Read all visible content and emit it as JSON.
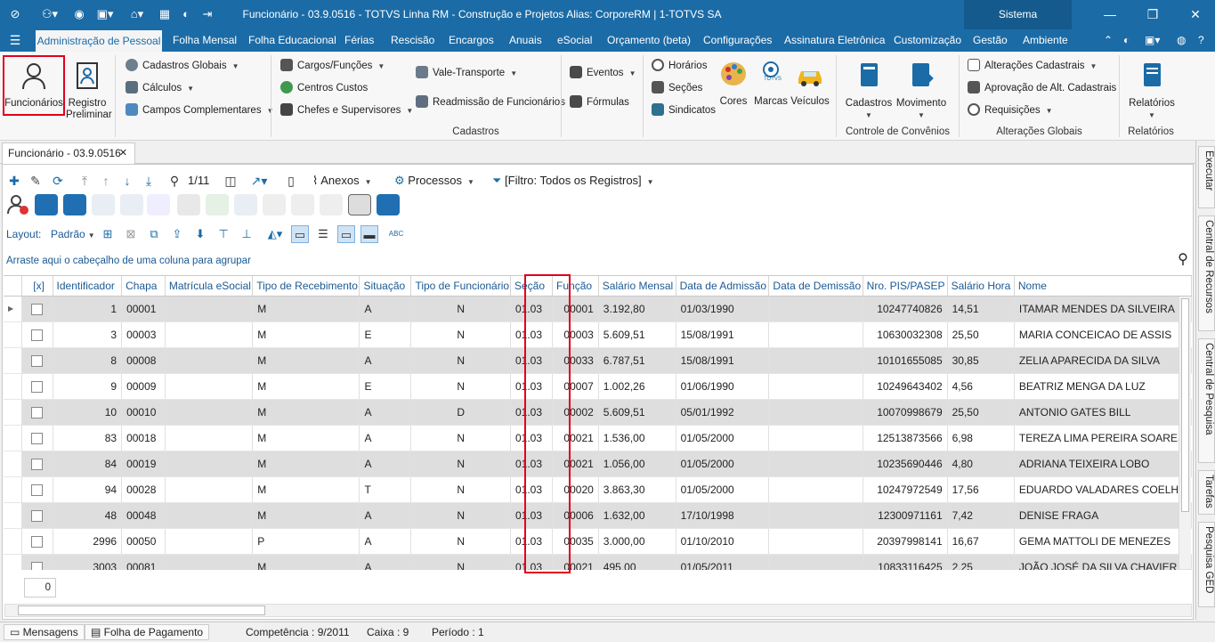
{
  "window": {
    "title": "Funcionário - 03.9.0516 - TOTVS Linha RM - Construção e Projetos  Alias: CorporeRM | 1-TOTVS SA",
    "system_label": "Sistema"
  },
  "ribbon_tabs": [
    "Administração de Pessoal",
    "Folha Mensal",
    "Folha Educacional",
    "Férias",
    "Rescisão",
    "Encargos",
    "Anuais",
    "eSocial",
    "Orçamento (beta)",
    "Configurações",
    "Assinatura Eletrônica",
    "Customização",
    "Gestão",
    "Ambiente"
  ],
  "ribbon": {
    "funcionarios": "Funcionários",
    "registro_preliminar_1": "Registro",
    "registro_preliminar_2": "Preliminar",
    "cadastros_globais": "Cadastros Globais",
    "calculos": "Cálculos",
    "campos_complementares": "Campos Complementares",
    "cargos_funcoes": "Cargos/Funções",
    "centros_custos": "Centros Custos",
    "chefes_supervisores": "Chefes e Supervisores",
    "vale_transporte": "Vale-Transporte",
    "readmissao": "Readmissão de Funcionários",
    "eventos": "Eventos",
    "formulas": "Fórmulas",
    "horarios": "Horários",
    "secoes": "Seções",
    "sindicatos": "Sindicatos",
    "cores": "Cores",
    "marcas": "Marcas",
    "veiculos": "Veículos",
    "cadastros_btn": "Cadastros",
    "movimento_btn": "Movimento",
    "alteracoes_cadastrais": "Alterações Cadastrais",
    "aprovacao_alt": "Aprovação de Alt. Cadastrais",
    "requisicoes": "Requisições",
    "relatorios_btn": "Relatórios",
    "totvs_logo": "TOTVS",
    "group_cadastros": "Cadastros",
    "group_convenios": "Controle de Convênios",
    "group_alteracoes": "Alterações Globais",
    "group_relatorios": "Relatórios"
  },
  "doc_tab": "Funcionário - 03.9.0516",
  "toolbar": {
    "pager": "1/11",
    "anexos": "Anexos",
    "processos": "Processos",
    "filtro": "[Filtro: Todos os Registros]",
    "layout_label": "Layout:",
    "layout_value": "Padrão",
    "group_hint": "Arraste aqui o cabeçalho de uma coluna para agrupar"
  },
  "grid": {
    "columns": [
      "[x]",
      "Identificador",
      "Chapa",
      "Matrícula eSocial",
      "Tipo de Recebimento",
      "Situação",
      "Tipo de Funcionário",
      "Seção",
      "Função",
      "Salário Mensal",
      "Data de Admissão",
      "Data de Demissão",
      "Nro. PIS/PASEP",
      "Salário Hora",
      "Nome"
    ],
    "rows": [
      [
        "1",
        "00001",
        "",
        "M",
        "A",
        "N",
        "01.03",
        "00001",
        "3.192,80",
        "01/03/1990",
        "",
        "10247740826",
        "14,51",
        "ITAMAR MENDES DA SILVEIRA"
      ],
      [
        "3",
        "00003",
        "",
        "M",
        "E",
        "N",
        "01.03",
        "00003",
        "5.609,51",
        "15/08/1991",
        "",
        "10630032308",
        "25,50",
        "MARIA CONCEICAO DE ASSIS"
      ],
      [
        "8",
        "00008",
        "",
        "M",
        "A",
        "N",
        "01.03",
        "00033",
        "6.787,51",
        "15/08/1991",
        "",
        "10101655085",
        "30,85",
        "ZELIA APARECIDA DA SILVA"
      ],
      [
        "9",
        "00009",
        "",
        "M",
        "E",
        "N",
        "01.03",
        "00007",
        "1.002,26",
        "01/06/1990",
        "",
        "10249643402",
        "4,56",
        "BEATRIZ MENGA DA LUZ"
      ],
      [
        "10",
        "00010",
        "",
        "M",
        "A",
        "D",
        "01.03",
        "00002",
        "5.609,51",
        "05/01/1992",
        "",
        "10070998679",
        "25,50",
        "ANTONIO GATES BILL"
      ],
      [
        "83",
        "00018",
        "",
        "M",
        "A",
        "N",
        "01.03",
        "00021",
        "1.536,00",
        "01/05/2000",
        "",
        "12513873566",
        "6,98",
        "TEREZA LIMA PEREIRA SOARES"
      ],
      [
        "84",
        "00019",
        "",
        "M",
        "A",
        "N",
        "01.03",
        "00021",
        "1.056,00",
        "01/05/2000",
        "",
        "10235690446",
        "4,80",
        "ADRIANA TEIXEIRA LOBO"
      ],
      [
        "94",
        "00028",
        "",
        "M",
        "T",
        "N",
        "01.03",
        "00020",
        "3.863,30",
        "01/05/2000",
        "",
        "10247972549",
        "17,56",
        "EDUARDO VALADARES COELHO"
      ],
      [
        "48",
        "00048",
        "",
        "M",
        "A",
        "N",
        "01.03",
        "00006",
        "1.632,00",
        "17/10/1998",
        "",
        "12300971161",
        "7,42",
        "DENISE FRAGA"
      ],
      [
        "2996",
        "00050",
        "",
        "P",
        "A",
        "N",
        "01.03",
        "00035",
        "3.000,00",
        "01/10/2010",
        "",
        "20397998141",
        "16,67",
        "GEMA MATTOLI DE MENEZES"
      ],
      [
        "3003",
        "00081",
        "",
        "M",
        "A",
        "N",
        "01.03",
        "00021",
        "495,00",
        "01/05/2011",
        "",
        "10833116425",
        "2,25",
        "JOÃO JOSÉ DA SILVA CHAVIER"
      ]
    ],
    "footer_count": "0"
  },
  "side_tabs": [
    "Executar",
    "Central de Recursos",
    "Central de Pesquisa",
    "Tarefas",
    "Pesquisa GED"
  ],
  "status": {
    "mensagens": "Mensagens",
    "folha": "Folha de Pagamento",
    "competencia": "Competência : 9/2011",
    "caixa": "Caixa : 9",
    "periodo": "Período : 1"
  },
  "colors": {
    "accent": "#1b6ba6",
    "highlight": "#e0001b"
  }
}
